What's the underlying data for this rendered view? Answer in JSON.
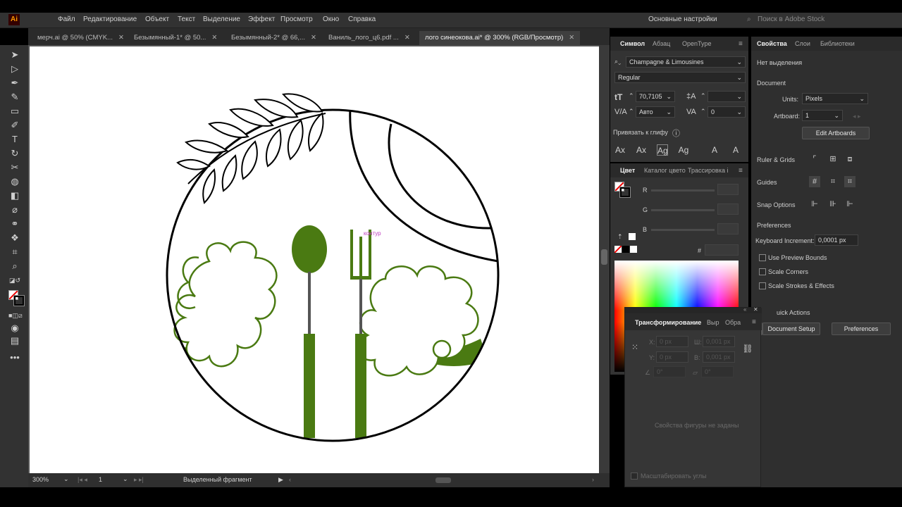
{
  "menubar": {
    "items": [
      "Файл",
      "Редактирование",
      "Объект",
      "Текст",
      "Выделение",
      "Эффект",
      "Просмотр",
      "Окно",
      "Справка"
    ],
    "workspace": "Основные настройки",
    "search_placeholder": "Поиск в Adobe Stock"
  },
  "tabs": [
    {
      "label": "мерч.ai @ 50% (CMYK..."
    },
    {
      "label": "Безымянный-1* @ 50..."
    },
    {
      "label": "Безымянный-2* @ 66,..."
    },
    {
      "label": "Ваниль_лого_ц6.pdf ..."
    },
    {
      "label": "лого синеокова.ai* @ 300% (RGB/Просмотр)"
    }
  ],
  "canvas": {
    "cursor_label": "контур"
  },
  "status": {
    "zoom": "300%",
    "artboard": "1",
    "info": "Выделенный фрагмент"
  },
  "character_panel": {
    "tabs": [
      "Символ",
      "Абзац",
      "OpenType"
    ],
    "font_family": "Champagne & Limousines",
    "font_style": "Regular",
    "font_size": "70,7105",
    "leading": "",
    "kerning": "Авто",
    "tracking": "0",
    "snap_label": "Привязать к глифу"
  },
  "color_panel": {
    "tabs": [
      "Цвет",
      "Каталог цвето",
      "Трассировка і"
    ],
    "r_label": "R",
    "g_label": "G",
    "b_label": "B",
    "hex_label": "#"
  },
  "properties_panel": {
    "tabs": [
      "Свойства",
      "Слои",
      "Библиотеки"
    ],
    "no_selection": "Нет выделения",
    "document_title": "Document",
    "units_label": "Units:",
    "units_value": "Pixels",
    "artboard_label": "Artboard:",
    "artboard_value": "1",
    "edit_artboards": "Edit Artboards",
    "ruler_grids": "Ruler & Grids",
    "guides": "Guides",
    "snap_options": "Snap Options",
    "preferences_title": "Preferences",
    "keyboard_increment_label": "Keyboard Increment:",
    "keyboard_increment_value": "0,0001 px",
    "use_preview_bounds": "Use Preview Bounds",
    "scale_corners": "Scale Corners",
    "scale_strokes": "Scale Strokes & Effects",
    "quick_actions": "uick Actions",
    "document_setup": "Document Setup",
    "preferences_btn": "Preferences"
  },
  "transform_panel": {
    "tabs": [
      "Трансформирование",
      "Выр",
      "Обра"
    ],
    "x_label": "X:",
    "x_value": "0 px",
    "y_label": "Y:",
    "y_value": "0 px",
    "w_label": "Ш:",
    "w_value": "0,001 px",
    "h_label": "В:",
    "h_value": "0,001 px",
    "angle_value": "0°",
    "shear_value": "0°",
    "no_shape": "Свойства фигуры не заданы",
    "scale_corners": "Масштабировать углы"
  },
  "colors": {
    "green": "#4a7a12",
    "panel_bg": "#333333",
    "accent_selected": "#3f3f3f"
  }
}
